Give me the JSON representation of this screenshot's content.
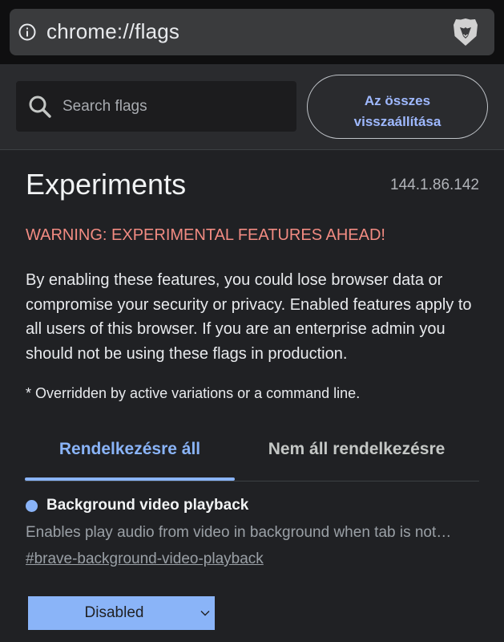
{
  "address_bar": {
    "url": "chrome://flags"
  },
  "toolbar": {
    "search_placeholder": "Search flags",
    "reset_label_line1": "Az összes",
    "reset_label_line2": "visszaállítása"
  },
  "page": {
    "title": "Experiments",
    "version": "144.1.86.142",
    "warning": "WARNING: EXPERIMENTAL FEATURES AHEAD!",
    "description": "By enabling these features, you could lose browser data or compromise your security or privacy. Enabled features apply to all users of this browser. If you are an enterprise admin you should not be using these flags in production.",
    "note": "* Overridden by active variations or a command line."
  },
  "tabs": [
    {
      "label": "Rendelkezésre áll",
      "active": true
    },
    {
      "label": "Nem áll rendelkezésre",
      "active": false
    }
  ],
  "flags": [
    {
      "title": "Background video playback",
      "description": "Enables play audio from video in background when tab is not…",
      "link": "#brave-background-video-playback",
      "selected": "Disabled"
    }
  ],
  "colors": {
    "accent": "#8ab4f8",
    "warning": "#f28b82",
    "background": "#202124"
  }
}
